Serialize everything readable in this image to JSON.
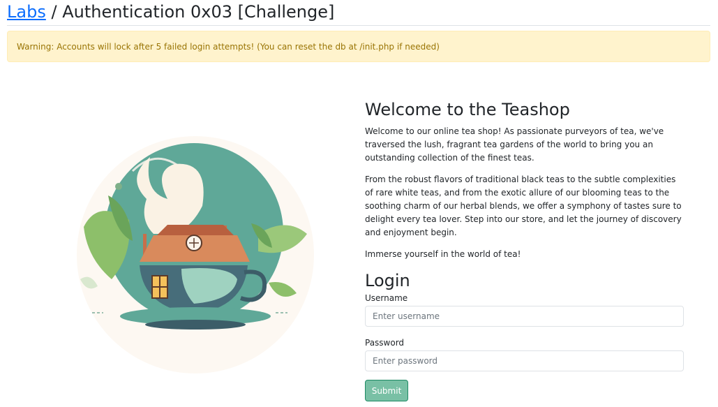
{
  "header": {
    "home_link": "Labs",
    "separator": "/",
    "title": "Authentication 0x03 [Challenge]"
  },
  "alert": {
    "text": "Warning: Accounts will lock after 5 failed login attempts! (You can reset the db at /init.php if needed)"
  },
  "welcome": {
    "title": "Welcome to the Teashop",
    "paragraphs": [
      "Welcome to our online tea shop! As passionate purveyors of tea, we've traversed the lush, fragrant tea gardens of the world to bring you an outstanding collection of the finest teas.",
      "From the robust flavors of traditional black teas to the subtle complexities of rare white teas, and from the exotic allure of our blooming teas to the soothing charm of our herbal blends, we offer a symphony of tastes sure to delight every tea lover. Step into our store, and let the journey of discovery and enjoyment begin.",
      "Immerse yourself in the world of tea!"
    ]
  },
  "login": {
    "title": "Login",
    "username_label": "Username",
    "username_placeholder": "Enter username",
    "username_value": "",
    "password_label": "Password",
    "password_placeholder": "Enter password",
    "password_value": "",
    "submit_label": "Submit"
  },
  "colors": {
    "link": "#0d6efd",
    "alert_bg": "#fff3cd",
    "alert_text": "#997404",
    "submit_bg": "#79c0a5",
    "teal": "#5fa898",
    "roof": "#d98a5c",
    "leaf": "#8dbf6a"
  }
}
